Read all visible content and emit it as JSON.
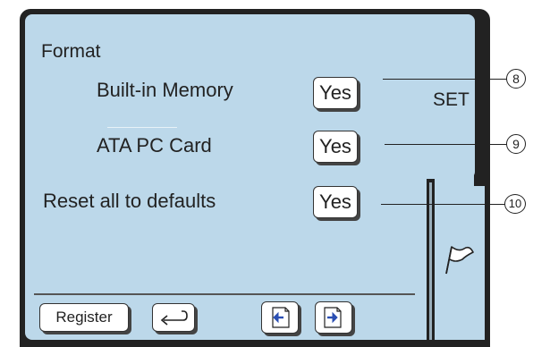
{
  "format": {
    "heading": "Format",
    "rows": [
      {
        "label": "Built-in Memory",
        "button": "Yes",
        "callout": "8"
      },
      {
        "label": "ATA PC Card",
        "button": "Yes",
        "callout": "9"
      }
    ]
  },
  "reset": {
    "label": "Reset all to defaults",
    "button": "Yes",
    "callout": "10"
  },
  "side": {
    "set_label": "SET",
    "flag_icon": "flag-icon"
  },
  "footer": {
    "register_label": "Register",
    "return_icon": "return-arrow-icon",
    "prev_icon": "page-prev-icon",
    "next_icon": "page-next-icon"
  },
  "colors": {
    "panel": "#bcd8ea",
    "frame": "#222222",
    "arrow": "#2b4fb3"
  }
}
